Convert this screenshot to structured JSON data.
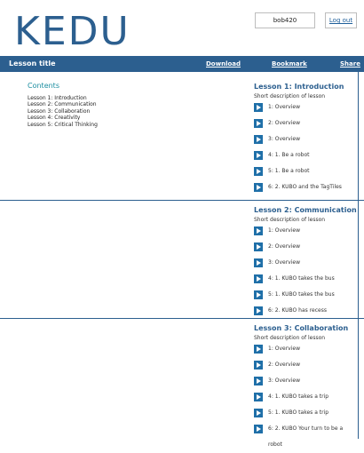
{
  "brand": {
    "logo_text": "KEDU"
  },
  "user": {
    "name": "bob420",
    "logout": "Log out"
  },
  "topbar": {
    "title": "Lesson title",
    "download": "Download",
    "bookmark": "Bookmark",
    "share": "Share"
  },
  "contents": {
    "heading": "Contents",
    "items": [
      "Lesson 1: Introduction",
      "Lesson 2: Communication",
      "Lesson 3: Collaboration",
      "Lesson 4: Creativity",
      "Lesson 5: Critical Thinking"
    ]
  },
  "lessons": [
    {
      "title": "Lesson 1: Introduction",
      "description": "Short description of lesson",
      "items": [
        "1: Overview",
        "2: Overview",
        "3: Overview",
        "4: 1. Be a robot",
        "5: 1. Be a robot",
        "6: 2. KUBO and the TagTiles"
      ]
    },
    {
      "title": "Lesson 2: Communication",
      "description": "Short description of lesson",
      "items": [
        "1: Overview",
        "2: Overview",
        "3: Overview",
        "4: 1. KUBO takes the bus",
        "5: 1. KUBO takes the bus",
        "6: 2. KUBO has recess"
      ]
    },
    {
      "title": "Lesson 3: Collaboration",
      "description": "Short description of lesson",
      "items": [
        "1: Overview",
        "2: Overview",
        "3: Overview",
        "4: 1. KUBO takes a trip",
        "5: 1. KUBO takes a trip",
        "6: 2. KUBO Your turn to be a robot"
      ]
    }
  ],
  "colors": {
    "brand": "#2c5f8f",
    "accent": "#1b8ea0",
    "icon": "#1f6fa8"
  }
}
